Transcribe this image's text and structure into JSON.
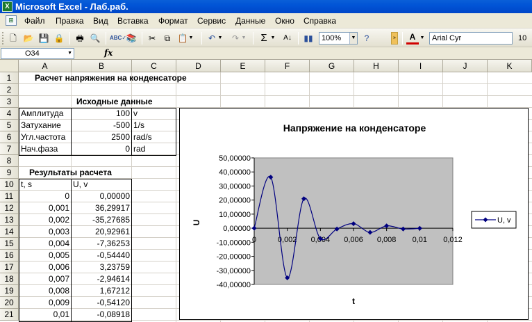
{
  "window": {
    "title": "Microsoft Excel - Лаб.раб."
  },
  "menu": [
    "Файл",
    "Правка",
    "Вид",
    "Вставка",
    "Формат",
    "Сервис",
    "Данные",
    "Окно",
    "Справка"
  ],
  "toolbar": {
    "zoom": "100%",
    "font_name": "Arial Cyr",
    "font_size": "10"
  },
  "formula_bar": {
    "name_box": "O34",
    "fx": "fx"
  },
  "columns": [
    "A",
    "B",
    "C",
    "D",
    "E",
    "F",
    "G",
    "H",
    "I",
    "J",
    "K"
  ],
  "rows": [
    "1",
    "2",
    "3",
    "4",
    "5",
    "6",
    "7",
    "8",
    "9",
    "10",
    "11",
    "12",
    "13",
    "14",
    "15",
    "16",
    "17",
    "18",
    "19",
    "20",
    "21"
  ],
  "sheet": {
    "title": "Расчет напряжения на конденсаторе",
    "input_header": "Исходные данные",
    "inputs": [
      {
        "label": "Амплитуда",
        "value": "100",
        "unit": "v"
      },
      {
        "label": "Затухание",
        "value": "-500",
        "unit": "1/s"
      },
      {
        "label": "Угл.частота",
        "value": "2500",
        "unit": "rad/s"
      },
      {
        "label": "Нач.фаза",
        "value": "0",
        "unit": "rad"
      }
    ],
    "results_header": "Результаты расчета",
    "results_col_t": "t, s",
    "results_col_u": "U, v",
    "results": [
      {
        "t": "0",
        "u": "0,00000"
      },
      {
        "t": "0,001",
        "u": "36,29917"
      },
      {
        "t": "0,002",
        "u": "-35,27685"
      },
      {
        "t": "0,003",
        "u": "20,92961"
      },
      {
        "t": "0,004",
        "u": "-7,36253"
      },
      {
        "t": "0,005",
        "u": "-0,54440"
      },
      {
        "t": "0,006",
        "u": "3,23759"
      },
      {
        "t": "0,007",
        "u": "-2,94614"
      },
      {
        "t": "0,008",
        "u": "1,67212"
      },
      {
        "t": "0,009",
        "u": "-0,54120"
      },
      {
        "t": "0,01",
        "u": "-0,08918"
      }
    ]
  },
  "chart_data": {
    "type": "line",
    "title": "Напряжение на конденсаторе",
    "xlabel": "t",
    "ylabel": "U",
    "x": [
      0,
      0.001,
      0.002,
      0.003,
      0.004,
      0.005,
      0.006,
      0.007,
      0.008,
      0.009,
      0.01
    ],
    "series": [
      {
        "name": "U, v",
        "values": [
          0,
          36.29917,
          -35.27685,
          20.92961,
          -7.36253,
          -0.5444,
          3.23759,
          -2.94614,
          1.67212,
          -0.5412,
          -0.08918
        ]
      }
    ],
    "xlim": [
      0,
      0.012
    ],
    "ylim": [
      -40,
      50
    ],
    "y_ticks": [
      "50,00000",
      "40,00000",
      "30,00000",
      "20,00000",
      "10,00000",
      "0,00000",
      "-10,00000",
      "-20,00000",
      "-30,00000",
      "-40,00000"
    ],
    "x_ticks": [
      "0",
      "0,002",
      "0,004",
      "0,006",
      "0,008",
      "0,01",
      "0,012"
    ],
    "plot_background": "#c0c0c0",
    "series_color": "#000080",
    "legend_position": "right",
    "grid": false
  }
}
